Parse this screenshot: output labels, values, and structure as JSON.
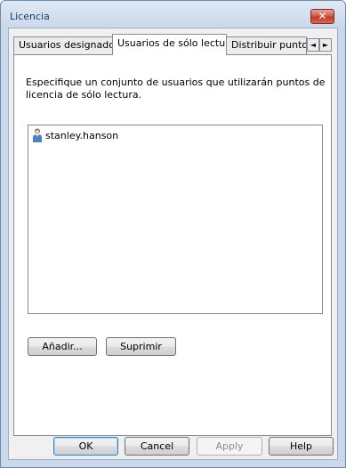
{
  "window": {
    "title": "Licencia",
    "close_glyph": "✕"
  },
  "tabs": [
    {
      "label": "Usuarios designados",
      "active": false
    },
    {
      "label": "Usuarios de sólo lectura",
      "active": true
    },
    {
      "label": "Distribuir puntos d",
      "active": false
    }
  ],
  "tab_scroll": {
    "left_icon": "triangle-left-icon",
    "right_icon": "triangle-right-icon",
    "left_glyph": "◄",
    "right_glyph": "►"
  },
  "panel": {
    "description": "Especifique un conjunto de usuarios que utilizarán puntos de licencia de sólo lectura.",
    "users": [
      {
        "name": "stanley.hanson",
        "icon": "user-icon"
      }
    ],
    "add_label": "Añadir...",
    "remove_label": "Suprimir"
  },
  "footer": {
    "ok_label": "OK",
    "cancel_label": "Cancel",
    "apply_label": "Apply",
    "help_label": "Help"
  }
}
